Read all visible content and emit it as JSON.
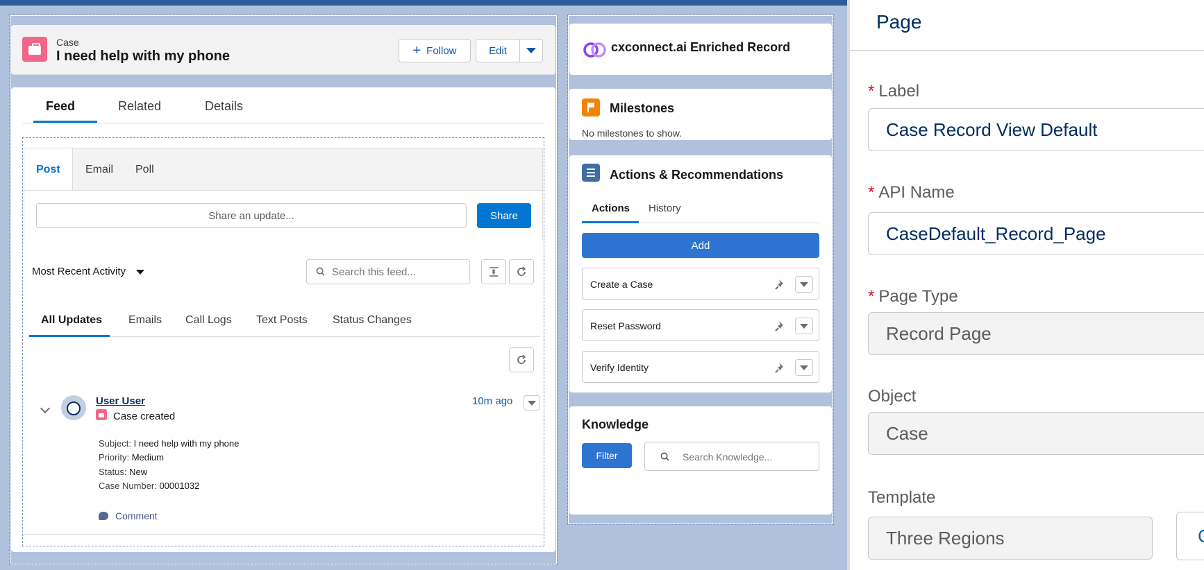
{
  "header": {
    "object_type": "Case",
    "record_title": "I need help with my phone",
    "follow_label": "Follow",
    "edit_label": "Edit"
  },
  "tabs": [
    "Feed",
    "Related",
    "Details"
  ],
  "publisher": {
    "tabs": [
      "Post",
      "Email",
      "Poll"
    ],
    "placeholder": "Share an update...",
    "share_label": "Share"
  },
  "feed": {
    "sort_label": "Most Recent Activity",
    "search_placeholder": "Search this feed...",
    "filters": [
      "All Updates",
      "Emails",
      "Call Logs",
      "Text Posts",
      "Status Changes"
    ],
    "post": {
      "user": "User User",
      "time": "10m ago",
      "action": "Case created",
      "details": [
        {
          "key": "Subject:",
          "value": "I need help with my phone"
        },
        {
          "key": "Priority:",
          "value": "Medium"
        },
        {
          "key": "Status:",
          "value": "New"
        },
        {
          "key": "Case Number:",
          "value": "00001032"
        }
      ],
      "comment_label": "Comment"
    }
  },
  "cx": {
    "title": "cxconnect.ai Enriched Record"
  },
  "milestones": {
    "title": "Milestones",
    "empty": "No milestones to show."
  },
  "actions": {
    "title": "Actions & Recommendations",
    "tabs": [
      "Actions",
      "History"
    ],
    "add_label": "Add",
    "items": [
      "Create a Case",
      "Reset Password",
      "Verify Identity"
    ]
  },
  "knowledge": {
    "title": "Knowledge",
    "filter_label": "Filter",
    "search_placeholder": "Search Knowledge..."
  },
  "props": {
    "title": "Page",
    "label_label": "Label",
    "label_value": "Case Record View Default",
    "api_label": "API Name",
    "api_value": "CaseDefault_Record_Page",
    "page_type_label": "Page Type",
    "page_type_value": "Record Page",
    "object_label": "Object",
    "object_value": "Case",
    "template_label": "Template",
    "template_value": "Three Regions",
    "edge_button_label": "C",
    "required_mark": "*"
  },
  "colors": {
    "accent": "#0176d3",
    "case_icon": "#f2668a",
    "milestone_icon": "#f38303",
    "actions_icon": "#3f6da5"
  }
}
